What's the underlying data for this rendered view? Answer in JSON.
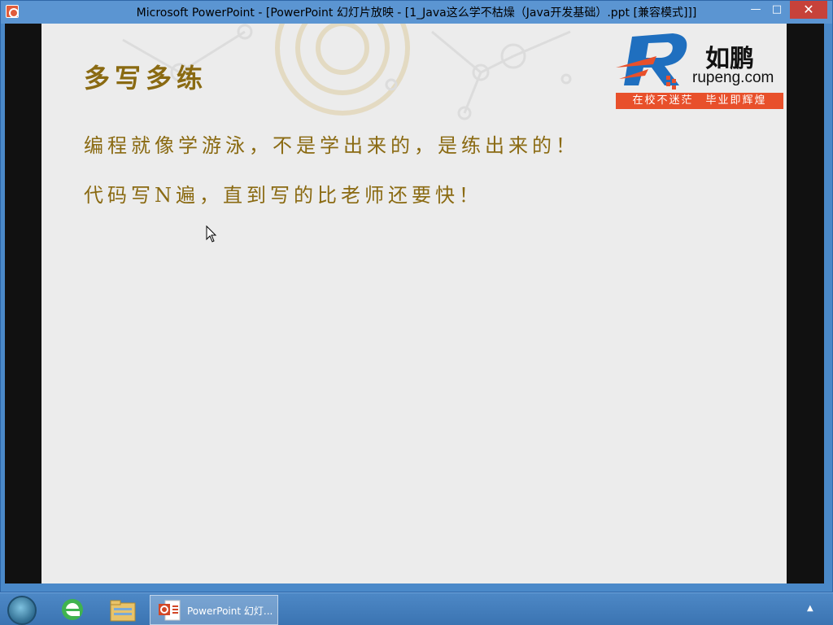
{
  "window": {
    "title": "Microsoft PowerPoint - [PowerPoint 幻灯片放映 - [1_Java这么学不枯燥（Java开发基础）.ppt [兼容模式]]]",
    "minimize_icon": "minimize-icon",
    "maximize_icon": "maximize-icon",
    "close_icon": "close-icon",
    "minimize_glyph": "—",
    "maximize_glyph": "□",
    "close_glyph": "✕"
  },
  "slide": {
    "title": "多写多练",
    "lines": [
      "编程就像学游泳，不是学出来的，是练出来的！",
      "代码写N遍，直到写的比老师还要快！"
    ],
    "text_color": "#8a6a12"
  },
  "logo": {
    "name_cn": "如鹏",
    "domain": "rupeng.com",
    "slogan": "在校不迷茫　毕业即辉煌",
    "accent_color": "#e8502b",
    "mark_color": "#1f6fbf"
  },
  "taskbar": {
    "start_icon": "start-orb-icon",
    "ie_icon": "ie-icon",
    "explorer_icon": "file-explorer-icon",
    "task_label": "PowerPoint 幻灯...",
    "tray_arrow": "▲"
  }
}
